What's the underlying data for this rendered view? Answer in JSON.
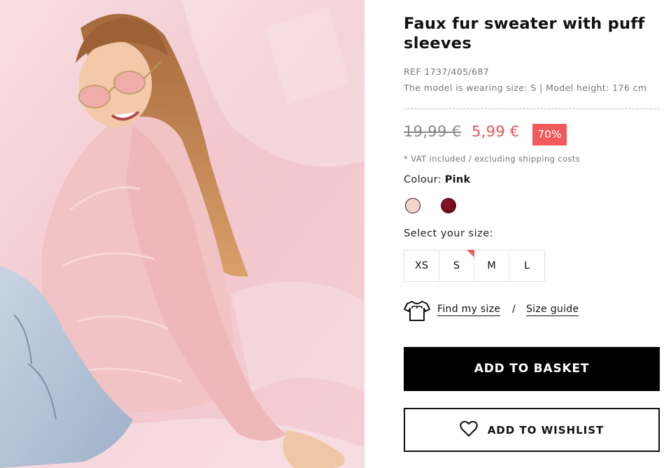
{
  "product": {
    "title": "Faux fur sweater with puff sleeves",
    "ref": "REF 1737/405/687",
    "model_info": "The model is wearing size: S | Model height: 176 cm",
    "old_price": "19,99 €",
    "new_price": "5,99 €",
    "discount": "70%",
    "vat_note": "* VAT included / excluding shipping costs"
  },
  "colour": {
    "label": "Colour:",
    "selected": "Pink",
    "swatches": [
      {
        "name": "Pink",
        "color": "#f4d5c9"
      },
      {
        "name": "Burgundy",
        "color": "#6e0f20"
      }
    ]
  },
  "size": {
    "label": "Select your size:",
    "options": [
      "XS",
      "S",
      "M",
      "L"
    ],
    "low_stock": "S"
  },
  "links": {
    "find_size": "Find my size",
    "separator": "/",
    "size_guide": "Size guide"
  },
  "actions": {
    "add_to_basket": "ADD TO BASKET",
    "add_to_wishlist": "ADD TO WISHLIST"
  },
  "colors": {
    "accent": "#f15a5a",
    "sale_price": "#ee5656"
  },
  "icons": {
    "fit": "tshirt-icon",
    "wishlist": "heart-icon"
  }
}
